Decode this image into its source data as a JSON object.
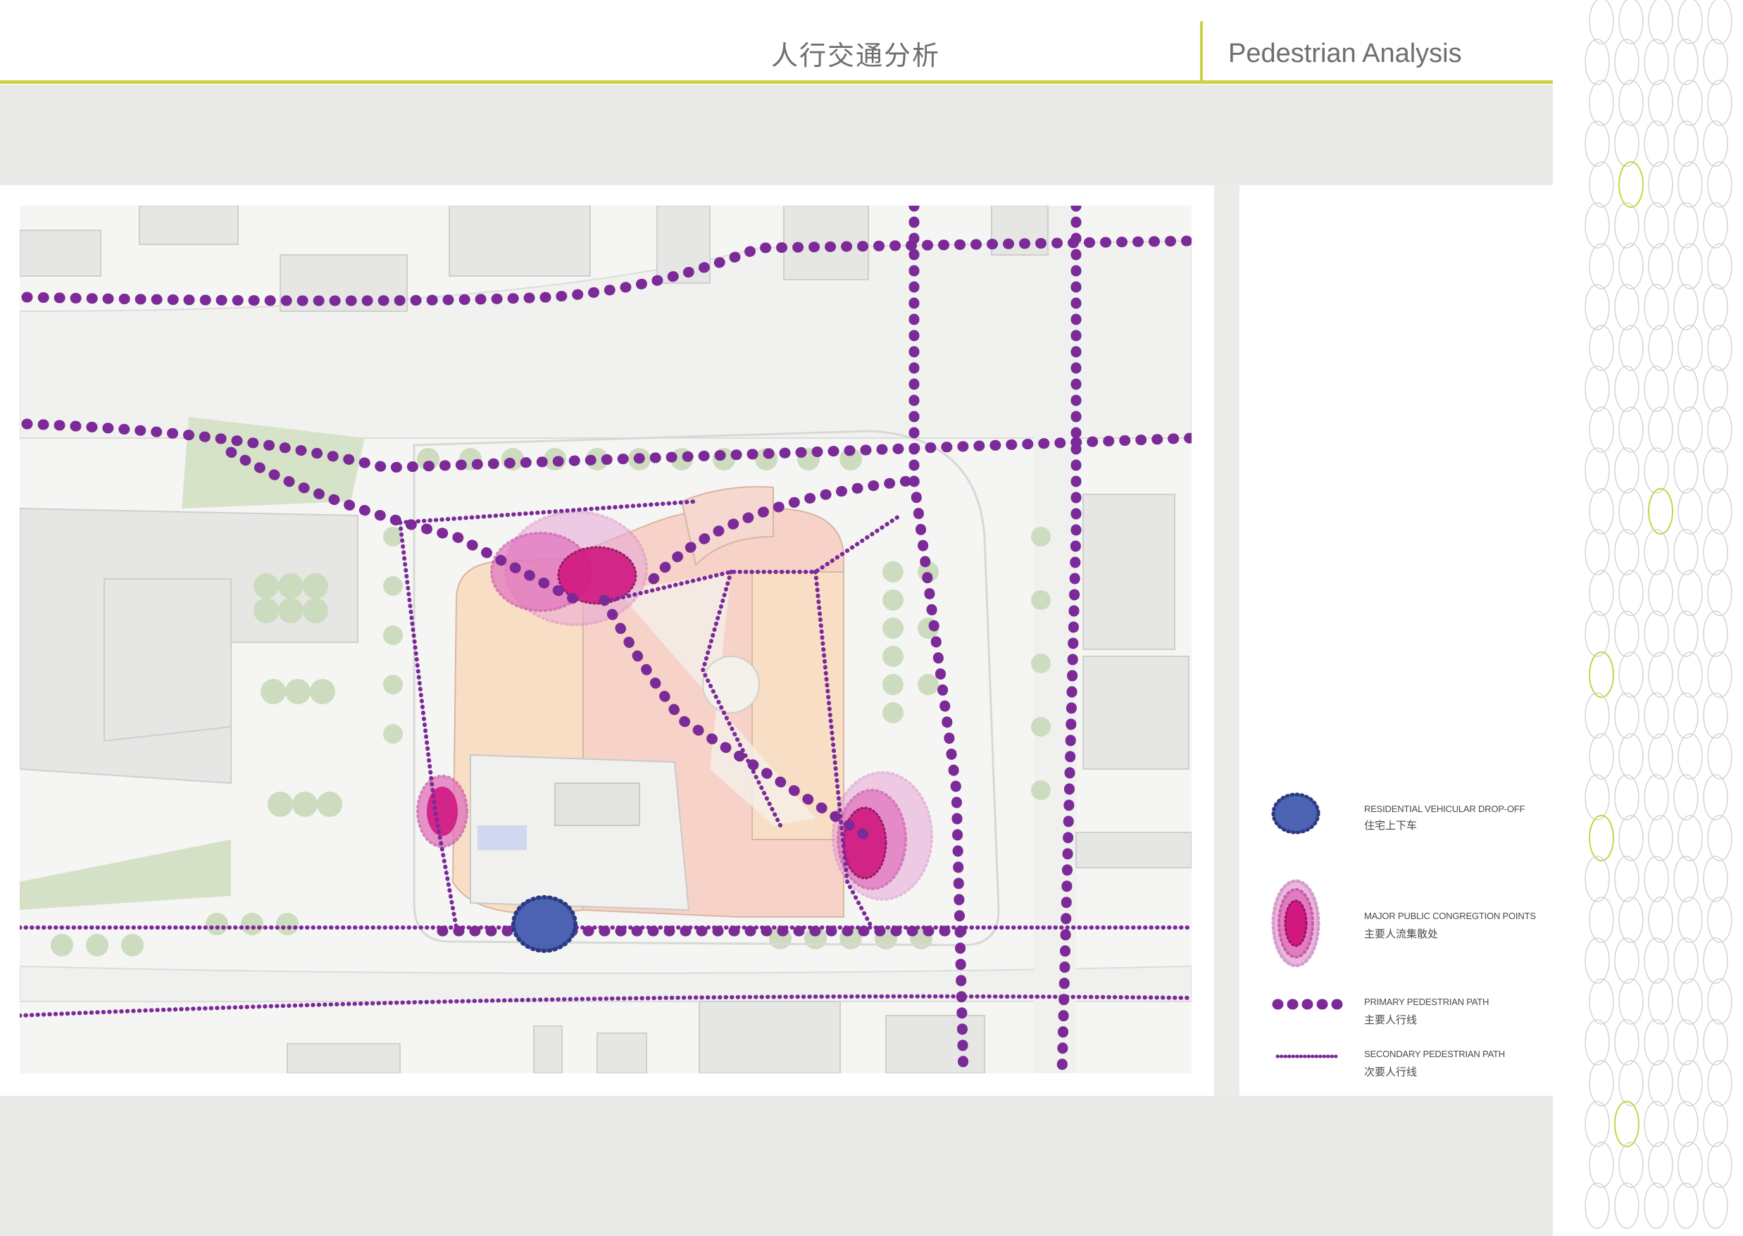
{
  "header": {
    "title_cn": "人行交通分析",
    "title_en": "Pedestrian Analysis"
  },
  "legend": {
    "items": [
      {
        "en": "RESIDENTIAL VEHICULAR DROP-OFF",
        "cn": "住宅上下车",
        "symbol": "blue-dropoff-icon"
      },
      {
        "en": "MAJOR PUBLIC CONGREGTION POINTS",
        "cn": "主要人流集散处",
        "symbol": "magenta-congregation-icon"
      },
      {
        "en": "PRIMARY PEDESTRIAN PATH",
        "cn": "主要人行线",
        "symbol": "primary-path-icon"
      },
      {
        "en": "SECONDARY PEDESTRIAN PATH",
        "cn": "次要人行线",
        "symbol": "secondary-path-icon"
      }
    ]
  },
  "colors": {
    "accent": "#cbd245",
    "path": "#7b2a98",
    "dropoff": "#3f56a6",
    "congregation": "#d0187f",
    "congregation_halo": "#e6a3d3",
    "band": "#e9e9e8",
    "text": "#6e6e6e"
  }
}
